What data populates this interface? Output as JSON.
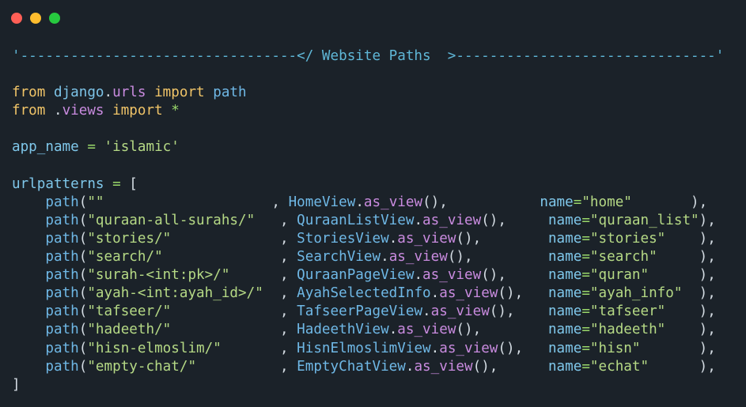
{
  "window": {
    "controls": {
      "close": {
        "icon": "close-dot-icon",
        "color": "#ff5f56"
      },
      "minimize": {
        "icon": "minimize-dot-icon",
        "color": "#ffbd2e"
      },
      "maximize": {
        "icon": "maximize-dot-icon",
        "color": "#27c93f"
      }
    },
    "background": "#1b2229"
  },
  "code": {
    "lines": [
      [
        {
          "t": "'---------------------------------</ Website Paths  >-------------------------------'",
          "k": "comment"
        }
      ],
      [],
      [
        {
          "t": "from",
          "k": "kw"
        },
        {
          "t": " ",
          "k": "punct"
        },
        {
          "t": "django",
          "k": "mod"
        },
        {
          "t": ".",
          "k": "punct"
        },
        {
          "t": "urls",
          "k": "attr"
        },
        {
          "t": " ",
          "k": "punct"
        },
        {
          "t": "import",
          "k": "kw"
        },
        {
          "t": " ",
          "k": "punct"
        },
        {
          "t": "path",
          "k": "fn"
        }
      ],
      [
        {
          "t": "from",
          "k": "kw"
        },
        {
          "t": " .",
          "k": "punct"
        },
        {
          "t": "views",
          "k": "attr"
        },
        {
          "t": " ",
          "k": "punct"
        },
        {
          "t": "import",
          "k": "kw"
        },
        {
          "t": " ",
          "k": "punct"
        },
        {
          "t": "*",
          "k": "op"
        }
      ],
      [],
      [
        {
          "t": "app_name",
          "k": "var"
        },
        {
          "t": " ",
          "k": "punct"
        },
        {
          "t": "=",
          "k": "op"
        },
        {
          "t": " ",
          "k": "punct"
        },
        {
          "t": "'islamic'",
          "k": "str"
        }
      ],
      [],
      [
        {
          "t": "urlpatterns",
          "k": "var"
        },
        {
          "t": " ",
          "k": "punct"
        },
        {
          "t": "=",
          "k": "op"
        },
        {
          "t": " [",
          "k": "punct"
        }
      ],
      [
        {
          "t": "    ",
          "k": "punct"
        },
        {
          "t": "path",
          "k": "fn"
        },
        {
          "t": "(",
          "k": "punct"
        },
        {
          "t": "\"\"                    ",
          "k": "str"
        },
        {
          "t": ", ",
          "k": "punct"
        },
        {
          "t": "HomeView",
          "k": "cls"
        },
        {
          "t": ".",
          "k": "punct"
        },
        {
          "t": "as_view",
          "k": "attr"
        },
        {
          "t": "(),           ",
          "k": "punct"
        },
        {
          "t": "name",
          "k": "param"
        },
        {
          "t": "=",
          "k": "op"
        },
        {
          "t": "\"home\"",
          "k": "str"
        },
        {
          "t": "       ),",
          "k": "punct"
        }
      ],
      [
        {
          "t": "    ",
          "k": "punct"
        },
        {
          "t": "path",
          "k": "fn"
        },
        {
          "t": "(",
          "k": "punct"
        },
        {
          "t": "\"quraan-all-surahs/\"   ",
          "k": "str"
        },
        {
          "t": ", ",
          "k": "punct"
        },
        {
          "t": "QuraanListView",
          "k": "cls"
        },
        {
          "t": ".",
          "k": "punct"
        },
        {
          "t": "as_view",
          "k": "attr"
        },
        {
          "t": "(),     ",
          "k": "punct"
        },
        {
          "t": "name",
          "k": "param"
        },
        {
          "t": "=",
          "k": "op"
        },
        {
          "t": "\"quraan_list\"",
          "k": "str"
        },
        {
          "t": "),",
          "k": "punct"
        }
      ],
      [
        {
          "t": "    ",
          "k": "punct"
        },
        {
          "t": "path",
          "k": "fn"
        },
        {
          "t": "(",
          "k": "punct"
        },
        {
          "t": "\"stories/\"             ",
          "k": "str"
        },
        {
          "t": ", ",
          "k": "punct"
        },
        {
          "t": "StoriesView",
          "k": "cls"
        },
        {
          "t": ".",
          "k": "punct"
        },
        {
          "t": "as_view",
          "k": "attr"
        },
        {
          "t": "(),        ",
          "k": "punct"
        },
        {
          "t": "name",
          "k": "param"
        },
        {
          "t": "=",
          "k": "op"
        },
        {
          "t": "\"stories\"",
          "k": "str"
        },
        {
          "t": "    ),",
          "k": "punct"
        }
      ],
      [
        {
          "t": "    ",
          "k": "punct"
        },
        {
          "t": "path",
          "k": "fn"
        },
        {
          "t": "(",
          "k": "punct"
        },
        {
          "t": "\"search/\"              ",
          "k": "str"
        },
        {
          "t": ", ",
          "k": "punct"
        },
        {
          "t": "SearchView",
          "k": "cls"
        },
        {
          "t": ".",
          "k": "punct"
        },
        {
          "t": "as_view",
          "k": "attr"
        },
        {
          "t": "(),         ",
          "k": "punct"
        },
        {
          "t": "name",
          "k": "param"
        },
        {
          "t": "=",
          "k": "op"
        },
        {
          "t": "\"search\"",
          "k": "str"
        },
        {
          "t": "     ),",
          "k": "punct"
        }
      ],
      [
        {
          "t": "    ",
          "k": "punct"
        },
        {
          "t": "path",
          "k": "fn"
        },
        {
          "t": "(",
          "k": "punct"
        },
        {
          "t": "\"surah-<int:pk>/\"      ",
          "k": "str"
        },
        {
          "t": ", ",
          "k": "punct"
        },
        {
          "t": "QuraanPageView",
          "k": "cls"
        },
        {
          "t": ".",
          "k": "punct"
        },
        {
          "t": "as_view",
          "k": "attr"
        },
        {
          "t": "(),     ",
          "k": "punct"
        },
        {
          "t": "name",
          "k": "param"
        },
        {
          "t": "=",
          "k": "op"
        },
        {
          "t": "\"quran\"",
          "k": "str"
        },
        {
          "t": "      ),",
          "k": "punct"
        }
      ],
      [
        {
          "t": "    ",
          "k": "punct"
        },
        {
          "t": "path",
          "k": "fn"
        },
        {
          "t": "(",
          "k": "punct"
        },
        {
          "t": "\"ayah-<int:ayah_id>/\"  ",
          "k": "str"
        },
        {
          "t": ", ",
          "k": "punct"
        },
        {
          "t": "AyahSelectedInfo",
          "k": "cls"
        },
        {
          "t": ".",
          "k": "punct"
        },
        {
          "t": "as_view",
          "k": "attr"
        },
        {
          "t": "(),   ",
          "k": "punct"
        },
        {
          "t": "name",
          "k": "param"
        },
        {
          "t": "=",
          "k": "op"
        },
        {
          "t": "\"ayah_info\"",
          "k": "str"
        },
        {
          "t": "  ),",
          "k": "punct"
        }
      ],
      [
        {
          "t": "    ",
          "k": "punct"
        },
        {
          "t": "path",
          "k": "fn"
        },
        {
          "t": "(",
          "k": "punct"
        },
        {
          "t": "\"tafseer/\"             ",
          "k": "str"
        },
        {
          "t": ", ",
          "k": "punct"
        },
        {
          "t": "TafseerPageView",
          "k": "cls"
        },
        {
          "t": ".",
          "k": "punct"
        },
        {
          "t": "as_view",
          "k": "attr"
        },
        {
          "t": "(),    ",
          "k": "punct"
        },
        {
          "t": "name",
          "k": "param"
        },
        {
          "t": "=",
          "k": "op"
        },
        {
          "t": "\"tafseer\"",
          "k": "str"
        },
        {
          "t": "    ),",
          "k": "punct"
        }
      ],
      [
        {
          "t": "    ",
          "k": "punct"
        },
        {
          "t": "path",
          "k": "fn"
        },
        {
          "t": "(",
          "k": "punct"
        },
        {
          "t": "\"hadeeth/\"             ",
          "k": "str"
        },
        {
          "t": ", ",
          "k": "punct"
        },
        {
          "t": "HadeethView",
          "k": "cls"
        },
        {
          "t": ".",
          "k": "punct"
        },
        {
          "t": "as_view",
          "k": "attr"
        },
        {
          "t": "(),        ",
          "k": "punct"
        },
        {
          "t": "name",
          "k": "param"
        },
        {
          "t": "=",
          "k": "op"
        },
        {
          "t": "\"hadeeth\"",
          "k": "str"
        },
        {
          "t": "    ),",
          "k": "punct"
        }
      ],
      [
        {
          "t": "    ",
          "k": "punct"
        },
        {
          "t": "path",
          "k": "fn"
        },
        {
          "t": "(",
          "k": "punct"
        },
        {
          "t": "\"hisn-elmoslim/\"       ",
          "k": "str"
        },
        {
          "t": ", ",
          "k": "punct"
        },
        {
          "t": "HisnElmoslimView",
          "k": "cls"
        },
        {
          "t": ".",
          "k": "punct"
        },
        {
          "t": "as_view",
          "k": "attr"
        },
        {
          "t": "(),   ",
          "k": "punct"
        },
        {
          "t": "name",
          "k": "param"
        },
        {
          "t": "=",
          "k": "op"
        },
        {
          "t": "\"hisn\"",
          "k": "str"
        },
        {
          "t": "       ),",
          "k": "punct"
        }
      ],
      [
        {
          "t": "    ",
          "k": "punct"
        },
        {
          "t": "path",
          "k": "fn"
        },
        {
          "t": "(",
          "k": "punct"
        },
        {
          "t": "\"empty-chat/\"          ",
          "k": "str"
        },
        {
          "t": ", ",
          "k": "punct"
        },
        {
          "t": "EmptyChatView",
          "k": "cls"
        },
        {
          "t": ".",
          "k": "punct"
        },
        {
          "t": "as_view",
          "k": "attr"
        },
        {
          "t": "(),      ",
          "k": "punct"
        },
        {
          "t": "name",
          "k": "param"
        },
        {
          "t": "=",
          "k": "op"
        },
        {
          "t": "\"echat\"",
          "k": "str"
        },
        {
          "t": "      ),",
          "k": "punct"
        }
      ],
      [
        {
          "t": "]",
          "k": "punct"
        }
      ]
    ]
  }
}
